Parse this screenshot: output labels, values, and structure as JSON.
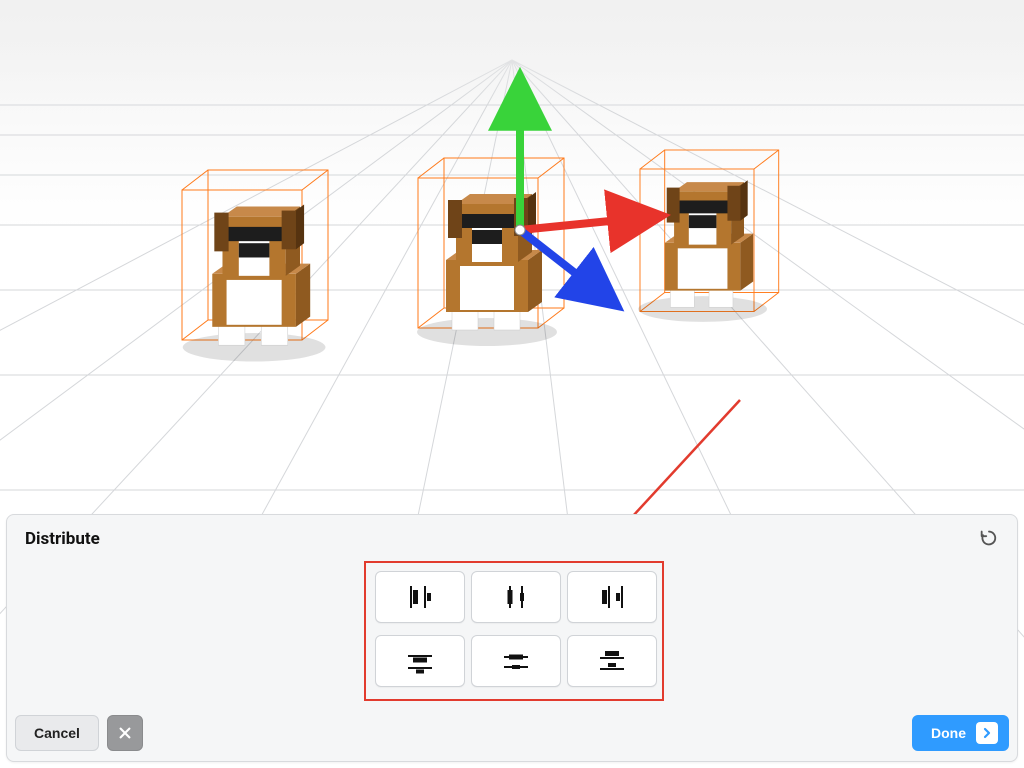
{
  "panel": {
    "title": "Distribute",
    "cancel_label": "Cancel",
    "done_label": "Done",
    "undo_name": "undo-icon",
    "distribute_options": [
      "distribute-horizontal-left",
      "distribute-horizontal-center",
      "distribute-horizontal-right",
      "distribute-vertical-top",
      "distribute-vertical-center",
      "distribute-vertical-bottom"
    ]
  },
  "scene": {
    "objects": [
      "voxel-dog",
      "voxel-dog",
      "voxel-dog"
    ],
    "gizmo_axes": {
      "x": "#e8332b",
      "y": "#39d33a",
      "z": "#2244e8"
    },
    "selection_color": "#ff7a1a",
    "annotation_arrow_color": "#e23b2e"
  }
}
